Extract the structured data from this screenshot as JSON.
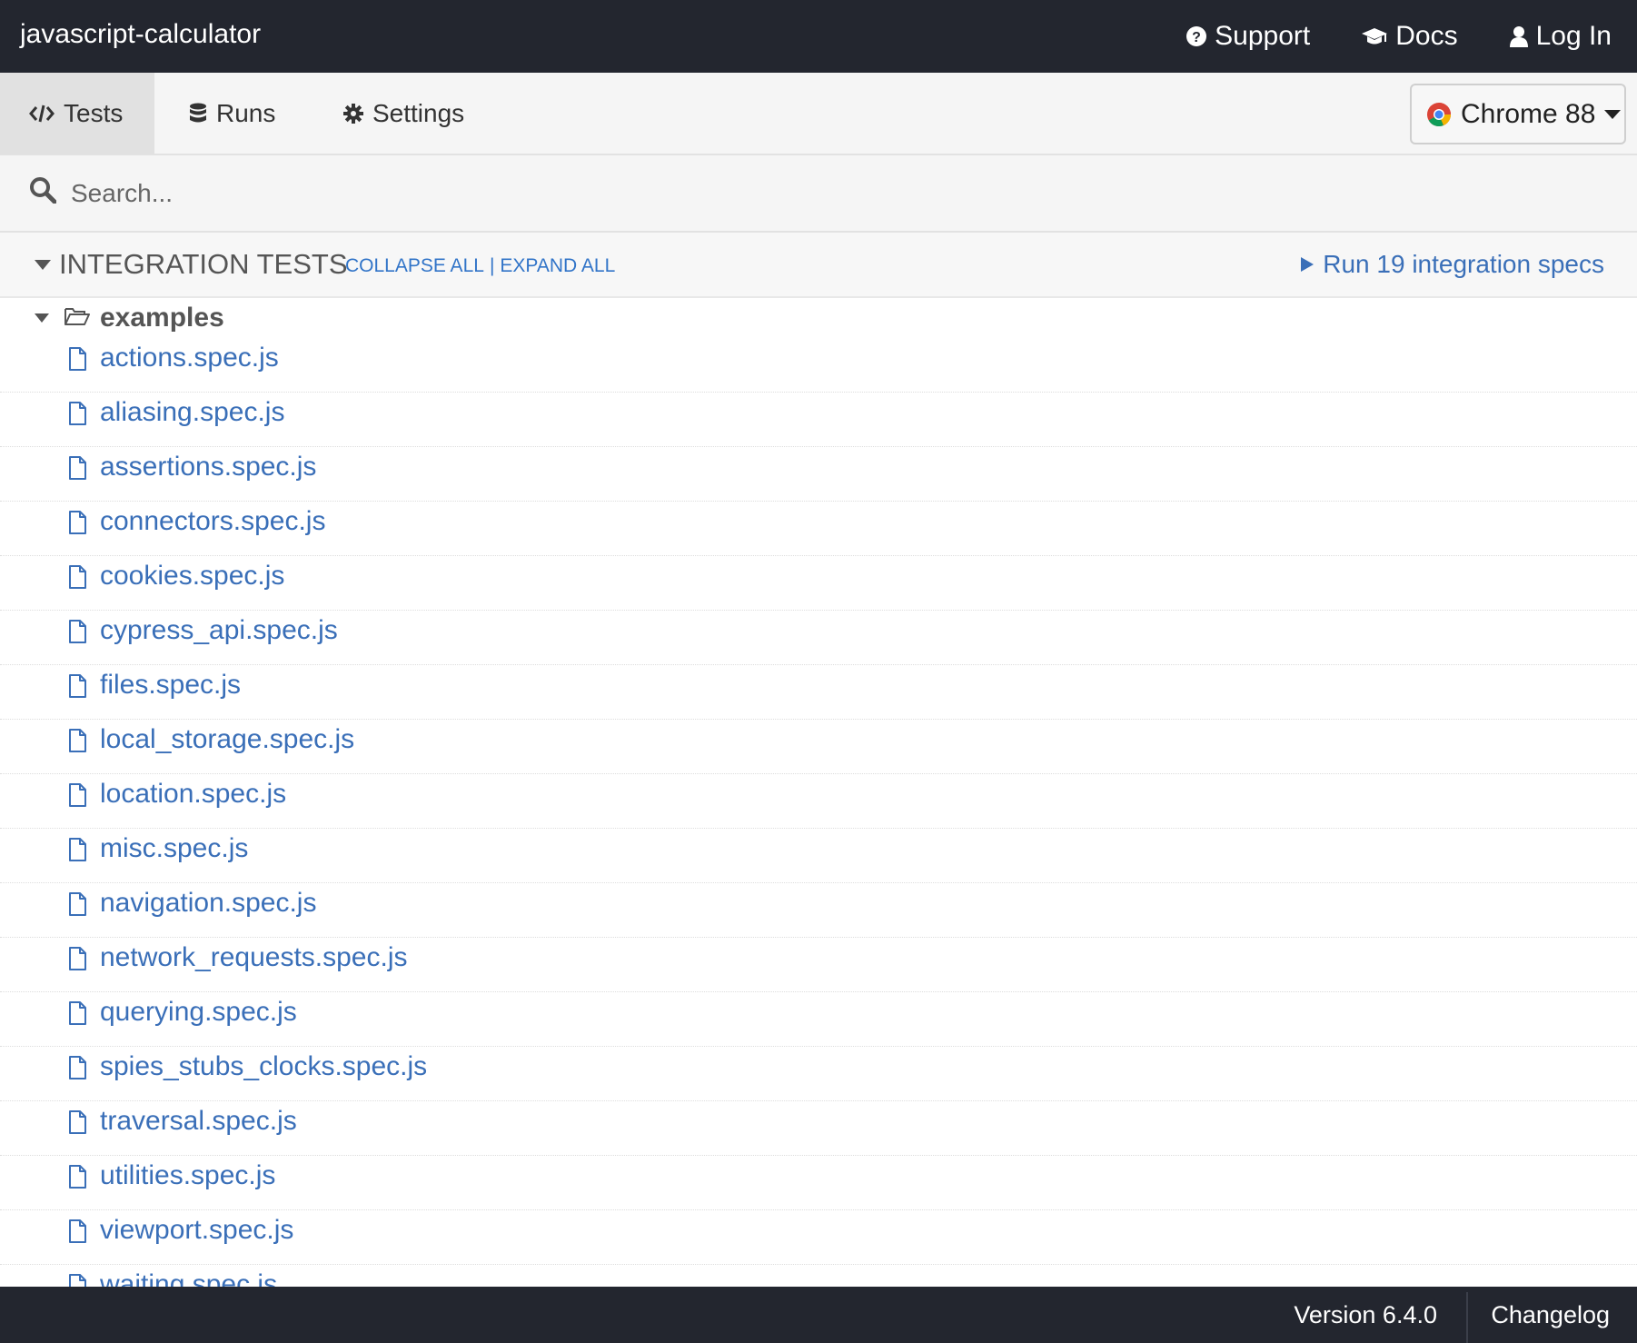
{
  "header": {
    "title": "javascript-calculator",
    "links": [
      {
        "label": "Support",
        "icon": "question-circle-icon"
      },
      {
        "label": "Docs",
        "icon": "graduation-cap-icon"
      },
      {
        "label": "Log In",
        "icon": "user-icon"
      }
    ]
  },
  "nav": {
    "tabs": [
      {
        "label": "Tests",
        "icon": "code-icon",
        "active": true
      },
      {
        "label": "Runs",
        "icon": "database-icon",
        "active": false
      },
      {
        "label": "Settings",
        "icon": "gear-icon",
        "active": false
      }
    ],
    "browser": {
      "label": "Chrome 88",
      "icon": "chrome-icon"
    }
  },
  "search": {
    "placeholder": "Search...",
    "value": ""
  },
  "integration": {
    "title": "INTEGRATION TESTS",
    "collapse_all": "COLLAPSE ALL",
    "separator": "|",
    "expand_all": "EXPAND ALL",
    "run_label": "Run 19 integration specs"
  },
  "tree": {
    "folder": "examples",
    "files": [
      "actions.spec.js",
      "aliasing.spec.js",
      "assertions.spec.js",
      "connectors.spec.js",
      "cookies.spec.js",
      "cypress_api.spec.js",
      "files.spec.js",
      "local_storage.spec.js",
      "location.spec.js",
      "misc.spec.js",
      "navigation.spec.js",
      "network_requests.spec.js",
      "querying.spec.js",
      "spies_stubs_clocks.spec.js",
      "traversal.spec.js",
      "utilities.spec.js",
      "viewport.spec.js",
      "waiting.spec.js"
    ]
  },
  "footer": {
    "version": "Version 6.4.0",
    "changelog": "Changelog"
  },
  "colors": {
    "header_bg": "#23262f",
    "link_blue": "#3a6fb8",
    "accent_blue": "#3174c8"
  }
}
